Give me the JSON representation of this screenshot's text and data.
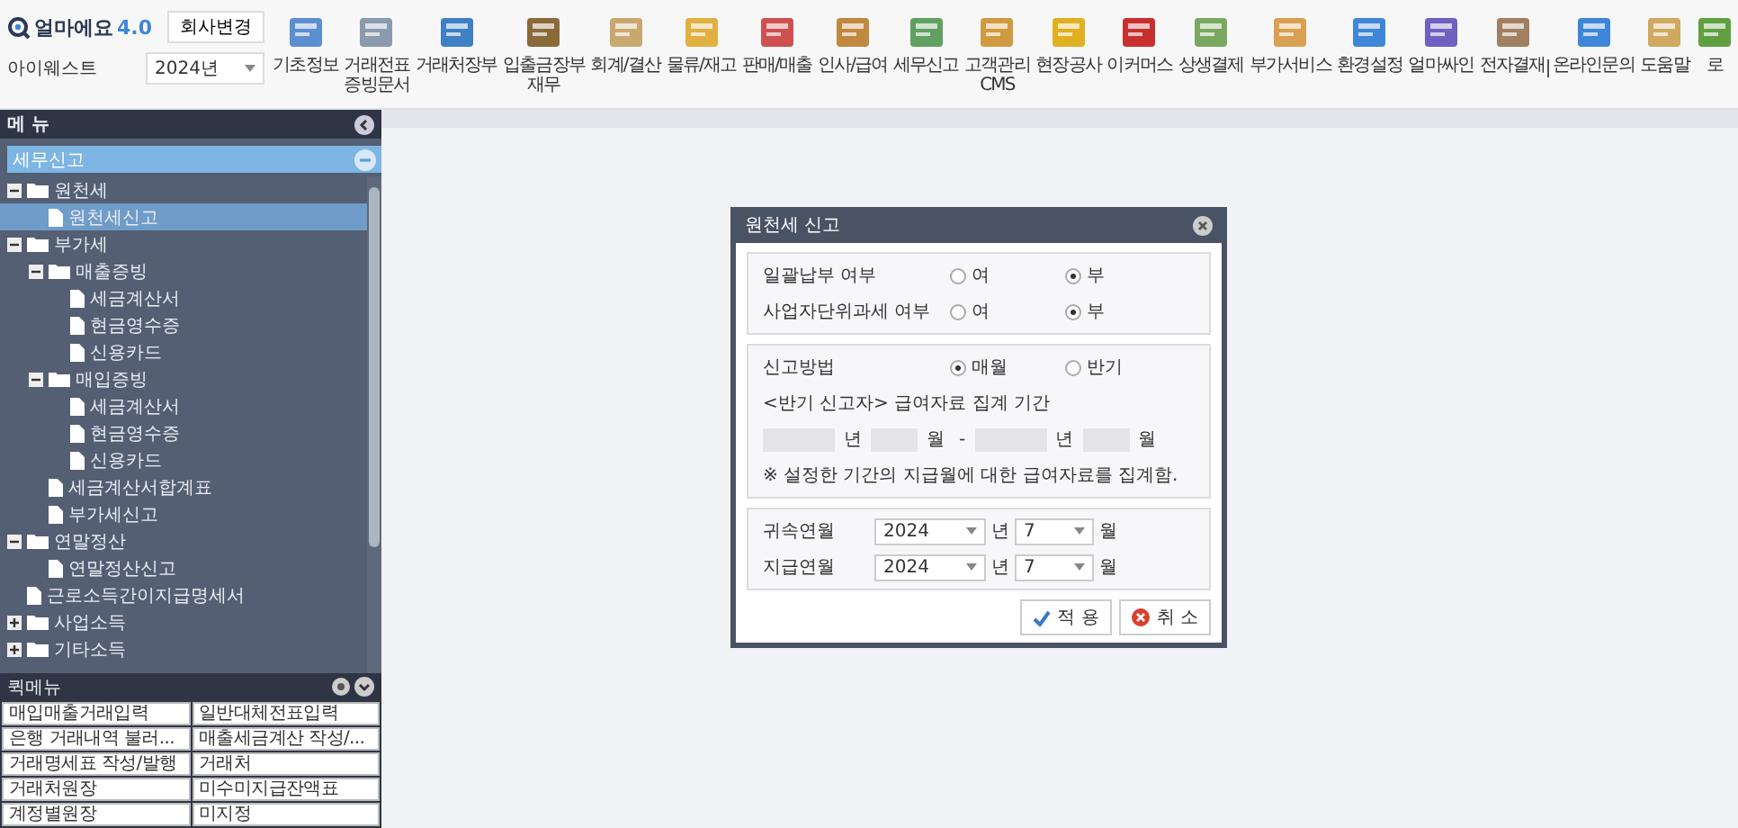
{
  "app": {
    "logo": "얼마에요",
    "version": "4.0",
    "company_button": "회사변경",
    "company": "아이웨스트",
    "year": "2024년"
  },
  "toolbar": [
    {
      "label": "기초정보"
    },
    {
      "label": "거래전표\n증빙문서"
    },
    {
      "label": "거래처장부"
    },
    {
      "label": "입출금장부\n재무"
    },
    {
      "label": "회계/결산"
    },
    {
      "label": "물류/재고"
    },
    {
      "label": "판매/매출"
    },
    {
      "label": "인사/급여"
    },
    {
      "label": "세무신고"
    },
    {
      "label": "고객관리\nCMS"
    },
    {
      "label": "현장공사"
    },
    {
      "label": "이커머스"
    },
    {
      "label": "상생결제"
    },
    {
      "label": "부가서비스"
    },
    {
      "label": "환경설정"
    },
    {
      "label": "얼마싸인"
    },
    {
      "label": "전자결재"
    },
    {
      "label": "온라인문의"
    },
    {
      "label": "도움말"
    },
    {
      "label": "로"
    }
  ],
  "sidebar": {
    "title": "메 뉴",
    "section": "세무신고",
    "tree": [
      {
        "label": "원천세",
        "kind": "folder",
        "expanded": true,
        "selected": false,
        "children": [
          {
            "label": "원천세신고",
            "kind": "file",
            "selected": true
          }
        ]
      },
      {
        "label": "부가세",
        "kind": "folder",
        "expanded": true,
        "selected": false,
        "children": [
          {
            "label": "매출증빙",
            "kind": "folder",
            "expanded": true,
            "selected": false,
            "children": [
              {
                "label": "세금계산서",
                "kind": "file",
                "selected": false
              },
              {
                "label": "현금영수증",
                "kind": "file",
                "selected": false
              },
              {
                "label": "신용카드",
                "kind": "file",
                "selected": false
              }
            ]
          },
          {
            "label": "매입증빙",
            "kind": "folder",
            "expanded": true,
            "selected": false,
            "children": [
              {
                "label": "세금계산서",
                "kind": "file",
                "selected": false
              },
              {
                "label": "현금영수증",
                "kind": "file",
                "selected": false
              },
              {
                "label": "신용카드",
                "kind": "file",
                "selected": false
              }
            ]
          },
          {
            "label": "세금계산서합계표",
            "kind": "file",
            "selected": false
          },
          {
            "label": "부가세신고",
            "kind": "file",
            "selected": false
          }
        ]
      },
      {
        "label": "연말정산",
        "kind": "folder",
        "expanded": true,
        "selected": false,
        "children": [
          {
            "label": "연말정산신고",
            "kind": "file",
            "selected": false
          }
        ]
      },
      {
        "label": "근로소득간이지급명세서",
        "kind": "file",
        "selected": false
      },
      {
        "label": "사업소득",
        "kind": "folder",
        "expanded": false,
        "selected": false
      },
      {
        "label": "기타소득",
        "kind": "folder",
        "expanded": false,
        "selected": false
      }
    ],
    "quick_title": "퀵메뉴",
    "quick_items": [
      "매입매출거래입력",
      "일반대체전표입력",
      "은행 거래내역 불러...",
      "매출세금계산 작성/...",
      "거래명세표 작성/발행",
      "거래처",
      "거래처원장",
      "미수미지급잔액표",
      "계정별원장",
      "미지정"
    ]
  },
  "dialog": {
    "title": "원천세 신고",
    "options": [
      {
        "label": "일괄납부 여부",
        "choices": [
          {
            "label": "여",
            "selected": false
          },
          {
            "label": "부",
            "selected": true
          }
        ]
      },
      {
        "label": "사업자단위과세 여부",
        "choices": [
          {
            "label": "여",
            "selected": false
          },
          {
            "label": "부",
            "selected": true
          }
        ]
      }
    ],
    "method": {
      "label": "신고방법",
      "choices": [
        {
          "label": "매월",
          "selected": true
        },
        {
          "label": "반기",
          "selected": false
        }
      ]
    },
    "period_caption": "<반기 신고자> 급여자료 집계 기간",
    "period_units": [
      "년",
      "월",
      "-",
      "년",
      "월"
    ],
    "note": "※ 설정한 기간의 지급월에 대한 급여자료를 집계함.",
    "dates": [
      {
        "label": "귀속연월",
        "year": "2024",
        "year_unit": "년",
        "month": "7",
        "month_unit": "월"
      },
      {
        "label": "지급연월",
        "year": "2024",
        "year_unit": "년",
        "month": "7",
        "month_unit": "월"
      }
    ],
    "buttons": [
      {
        "label": "적 용",
        "kind": "apply"
      },
      {
        "label": "취 소",
        "kind": "cancel"
      }
    ]
  }
}
